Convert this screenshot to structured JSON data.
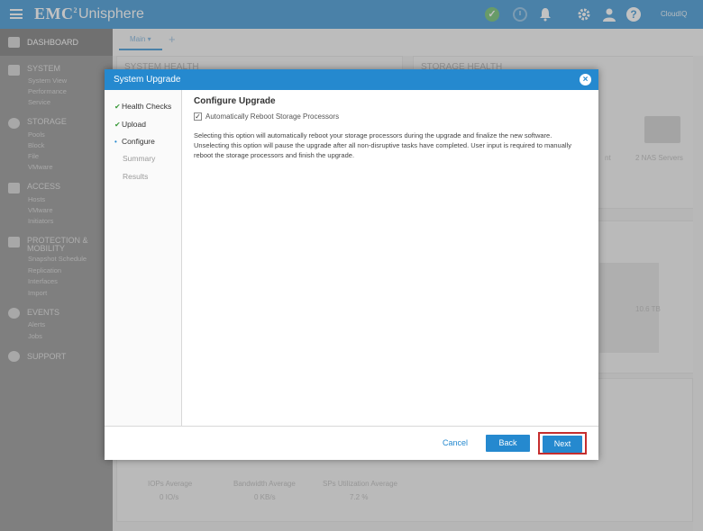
{
  "app": {
    "brand": "EMC",
    "brand_sup": "2",
    "name": "Unisphere",
    "cloudiq": "CloudIQ"
  },
  "sidebar": {
    "dashboard": "DASHBOARD",
    "sections": [
      {
        "label": "SYSTEM",
        "items": [
          "System View",
          "Performance",
          "Service"
        ]
      },
      {
        "label": "STORAGE",
        "items": [
          "Pools",
          "Block",
          "File",
          "VMware"
        ]
      },
      {
        "label": "ACCESS",
        "items": [
          "Hosts",
          "VMware",
          "Initiators"
        ]
      },
      {
        "label": "PROTECTION &",
        "label2": "MOBILITY",
        "items": [
          "Snapshot Schedule",
          "Replication",
          "Interfaces",
          "Import"
        ]
      },
      {
        "label": "EVENTS",
        "items": [
          "Alerts",
          "Jobs"
        ]
      },
      {
        "label": "SUPPORT",
        "items": []
      }
    ]
  },
  "tabs": {
    "main": "Main ▾",
    "add": "+"
  },
  "background": {
    "system_health": "SYSTEM HEALTH",
    "storage_health": "STORAGE HEALTH",
    "capacity_value": "10.6 TB",
    "iops_label": "IOPs Average",
    "iops_value": "0 IO/s",
    "bandwidth_label": "Bandwidth Average",
    "bandwidth_value": "0 KB/s",
    "sp_label": "SPs Utilization Average",
    "sp_value": "7.2 %",
    "nas_label": "2 NAS Servers",
    "bg_frag": "nt"
  },
  "modal": {
    "title": "System Upgrade",
    "steps": [
      {
        "label": "Health Checks",
        "state": "done"
      },
      {
        "label": "Upload",
        "state": "done"
      },
      {
        "label": "Configure",
        "state": "active"
      },
      {
        "label": "Summary",
        "state": "pending"
      },
      {
        "label": "Results",
        "state": "pending"
      }
    ],
    "heading": "Configure Upgrade",
    "checkbox_label": "Automatically Reboot Storage Processors",
    "checkbox_checked": true,
    "description": "Selecting this option will automatically reboot your storage processors during the upgrade and finalize the new software. Unselecting this option will pause the upgrade after all non-disruptive tasks have completed. User input is required to manually reboot the storage processors and finish the upgrade.",
    "cancel": "Cancel",
    "back": "Back",
    "next": "Next"
  },
  "colors": {
    "accent": "#2589cf",
    "highlight": "#c52e2e",
    "success": "#3a9a3a"
  }
}
